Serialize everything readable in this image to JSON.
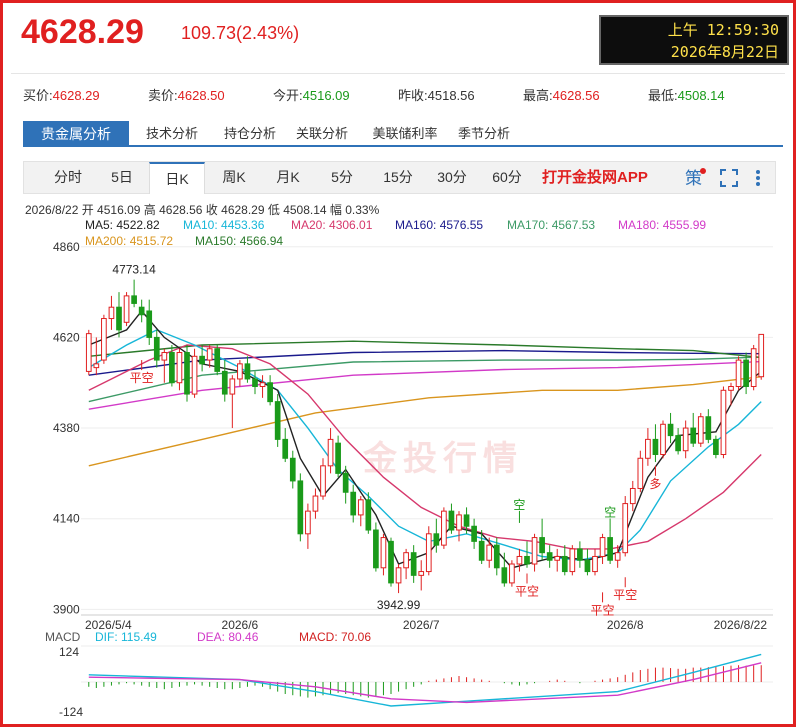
{
  "header": {
    "last_price": "4628.29",
    "change": "109.73(2.43%)",
    "clock_time": "上午 12:59:30",
    "clock_date": "2026年8月22日"
  },
  "quote": [
    {
      "label": "买价:",
      "value": "4628.29",
      "dir": "up"
    },
    {
      "label": "卖价:",
      "value": "4628.50",
      "dir": "up"
    },
    {
      "label": "今开:",
      "value": "4516.09",
      "dir": "down"
    },
    {
      "label": "昨收:",
      "value": "4518.56",
      "dir": "flat"
    },
    {
      "label": "最高:",
      "value": "4628.56",
      "dir": "up"
    },
    {
      "label": "最低:",
      "value": "4508.14",
      "dir": "down"
    }
  ],
  "nav_tabs": [
    "贵金属分析",
    "技术分析",
    "持仓分析",
    "关联分析",
    "美联储利率",
    "季节分析"
  ],
  "period_tabs": [
    "分时",
    "5日",
    "日K",
    "周K",
    "月K",
    "5分",
    "15分",
    "30分",
    "60分"
  ],
  "app_link": "打开金投网APP",
  "icons": {
    "settings": "settings-icon",
    "fullscreen": "fullscreen-icon",
    "more": "more-icon"
  },
  "ohlc_text": "2026/8/22 开 4516.09 高 4628.56 收 4628.29 低 4508.14 幅 0.33%",
  "ma_legend": [
    {
      "text": "MA5: 4522.82",
      "color": "#222222"
    },
    {
      "text": "MA10: 4453.36",
      "color": "#17b6d8"
    },
    {
      "text": "MA20: 4306.01",
      "color": "#d6386c"
    },
    {
      "text": "MA160: 4576.55",
      "color": "#1a1a8c"
    },
    {
      "text": "MA170: 4567.53",
      "color": "#3c9a66"
    },
    {
      "text": "MA180: 4555.99",
      "color": "#d23ac8"
    },
    {
      "text": "MA200: 4515.72",
      "color": "#d9951e"
    },
    {
      "text": "MA150: 4566.94",
      "color": "#2a7a2a"
    }
  ],
  "macd_legend": [
    {
      "text": "MACD",
      "color": "#555555"
    },
    {
      "text": "DIF: 115.49",
      "color": "#17b6d8"
    },
    {
      "text": "DEA: 80.46",
      "color": "#d23ac8"
    },
    {
      "text": "MACD: 70.06",
      "color": "#d12020"
    }
  ],
  "watermark": "金投行情",
  "colors": {
    "up": "#e02020",
    "down": "#1a9a1a",
    "accent": "#2f72b8"
  },
  "chart_data": {
    "type": "candlestick",
    "y_ticks": [
      4860,
      4620,
      4380,
      4140,
      3900
    ],
    "ylim": [
      3885,
      4870
    ],
    "x_ticks": [
      "2026/5/4",
      "2026/6",
      "2026/7",
      "2026/8",
      "2026/8/22"
    ],
    "annotations": {
      "high": "4773.14",
      "low": "3942.99"
    },
    "signals": [
      "平空",
      "空",
      "平空",
      "空",
      "平空",
      "平空",
      "多"
    ],
    "candles": [
      {
        "o": 4530,
        "h": 4640,
        "l": 4520,
        "c": 4630
      },
      {
        "o": 4540,
        "h": 4620,
        "l": 4520,
        "c": 4550
      },
      {
        "o": 4560,
        "h": 4680,
        "l": 4550,
        "c": 4670
      },
      {
        "o": 4670,
        "h": 4730,
        "l": 4640,
        "c": 4700
      },
      {
        "o": 4700,
        "h": 4740,
        "l": 4620,
        "c": 4640
      },
      {
        "o": 4660,
        "h": 4740,
        "l": 4650,
        "c": 4730
      },
      {
        "o": 4730,
        "h": 4773,
        "l": 4700,
        "c": 4710
      },
      {
        "o": 4700,
        "h": 4720,
        "l": 4660,
        "c": 4680
      },
      {
        "o": 4690,
        "h": 4720,
        "l": 4600,
        "c": 4620
      },
      {
        "o": 4620,
        "h": 4640,
        "l": 4540,
        "c": 4560
      },
      {
        "o": 4560,
        "h": 4590,
        "l": 4500,
        "c": 4580
      },
      {
        "o": 4580,
        "h": 4600,
        "l": 4490,
        "c": 4500
      },
      {
        "o": 4500,
        "h": 4590,
        "l": 4480,
        "c": 4580
      },
      {
        "o": 4580,
        "h": 4600,
        "l": 4450,
        "c": 4470
      },
      {
        "o": 4470,
        "h": 4590,
        "l": 4460,
        "c": 4570
      },
      {
        "o": 4570,
        "h": 4600,
        "l": 4530,
        "c": 4550
      },
      {
        "o": 4560,
        "h": 4600,
        "l": 4540,
        "c": 4590
      },
      {
        "o": 4590,
        "h": 4600,
        "l": 4520,
        "c": 4530
      },
      {
        "o": 4530,
        "h": 4560,
        "l": 4450,
        "c": 4470
      },
      {
        "o": 4470,
        "h": 4520,
        "l": 4380,
        "c": 4510
      },
      {
        "o": 4510,
        "h": 4560,
        "l": 4490,
        "c": 4550
      },
      {
        "o": 4550,
        "h": 4570,
        "l": 4500,
        "c": 4510
      },
      {
        "o": 4510,
        "h": 4530,
        "l": 4470,
        "c": 4490
      },
      {
        "o": 4490,
        "h": 4520,
        "l": 4460,
        "c": 4500
      },
      {
        "o": 4500,
        "h": 4520,
        "l": 4440,
        "c": 4450
      },
      {
        "o": 4450,
        "h": 4470,
        "l": 4330,
        "c": 4350
      },
      {
        "o": 4350,
        "h": 4380,
        "l": 4290,
        "c": 4300
      },
      {
        "o": 4300,
        "h": 4320,
        "l": 4220,
        "c": 4240
      },
      {
        "o": 4240,
        "h": 4260,
        "l": 4080,
        "c": 4100
      },
      {
        "o": 4100,
        "h": 4180,
        "l": 4060,
        "c": 4160
      },
      {
        "o": 4160,
        "h": 4220,
        "l": 4140,
        "c": 4200
      },
      {
        "o": 4200,
        "h": 4300,
        "l": 4190,
        "c": 4280
      },
      {
        "o": 4280,
        "h": 4380,
        "l": 4260,
        "c": 4350
      },
      {
        "o": 4340,
        "h": 4360,
        "l": 4250,
        "c": 4260
      },
      {
        "o": 4260,
        "h": 4280,
        "l": 4180,
        "c": 4210
      },
      {
        "o": 4210,
        "h": 4230,
        "l": 4130,
        "c": 4150
      },
      {
        "o": 4150,
        "h": 4200,
        "l": 4120,
        "c": 4190
      },
      {
        "o": 4190,
        "h": 4210,
        "l": 4100,
        "c": 4110
      },
      {
        "o": 4110,
        "h": 4130,
        "l": 4000,
        "c": 4010
      },
      {
        "o": 4010,
        "h": 4100,
        "l": 3990,
        "c": 4090
      },
      {
        "o": 4080,
        "h": 4090,
        "l": 3960,
        "c": 3970
      },
      {
        "o": 3970,
        "h": 4020,
        "l": 3943,
        "c": 4010
      },
      {
        "o": 4010,
        "h": 4060,
        "l": 3980,
        "c": 4050
      },
      {
        "o": 4050,
        "h": 4070,
        "l": 3970,
        "c": 3990
      },
      {
        "o": 3990,
        "h": 4030,
        "l": 3950,
        "c": 4000
      },
      {
        "o": 4000,
        "h": 4120,
        "l": 3990,
        "c": 4100
      },
      {
        "o": 4100,
        "h": 4140,
        "l": 4050,
        "c": 4070
      },
      {
        "o": 4070,
        "h": 4170,
        "l": 4060,
        "c": 4160
      },
      {
        "o": 4160,
        "h": 4180,
        "l": 4100,
        "c": 4110
      },
      {
        "o": 4110,
        "h": 4160,
        "l": 4080,
        "c": 4150
      },
      {
        "o": 4150,
        "h": 4170,
        "l": 4100,
        "c": 4120
      },
      {
        "o": 4120,
        "h": 4140,
        "l": 4060,
        "c": 4080
      },
      {
        "o": 4080,
        "h": 4110,
        "l": 4020,
        "c": 4030
      },
      {
        "o": 4030,
        "h": 4090,
        "l": 4010,
        "c": 4070
      },
      {
        "o": 4070,
        "h": 4090,
        "l": 3990,
        "c": 4010
      },
      {
        "o": 4010,
        "h": 4050,
        "l": 3960,
        "c": 3970
      },
      {
        "o": 3970,
        "h": 4030,
        "l": 3960,
        "c": 4020
      },
      {
        "o": 4020,
        "h": 4060,
        "l": 4000,
        "c": 4040
      },
      {
        "o": 4040,
        "h": 4080,
        "l": 4010,
        "c": 4020
      },
      {
        "o": 4020,
        "h": 4100,
        "l": 4000,
        "c": 4090
      },
      {
        "o": 4090,
        "h": 4140,
        "l": 4030,
        "c": 4050
      },
      {
        "o": 4050,
        "h": 4070,
        "l": 4010,
        "c": 4030
      },
      {
        "o": 4030,
        "h": 4060,
        "l": 4000,
        "c": 4040
      },
      {
        "o": 4040,
        "h": 4070,
        "l": 3990,
        "c": 4000
      },
      {
        "o": 4000,
        "h": 4070,
        "l": 3990,
        "c": 4060
      },
      {
        "o": 4060,
        "h": 4080,
        "l": 4010,
        "c": 4030
      },
      {
        "o": 4030,
        "h": 4060,
        "l": 3990,
        "c": 4000
      },
      {
        "o": 4000,
        "h": 4060,
        "l": 3990,
        "c": 4040
      },
      {
        "o": 4040,
        "h": 4100,
        "l": 4020,
        "c": 4090
      },
      {
        "o": 4090,
        "h": 4110,
        "l": 4020,
        "c": 4030
      },
      {
        "o": 4030,
        "h": 4070,
        "l": 4010,
        "c": 4050
      },
      {
        "o": 4050,
        "h": 4200,
        "l": 4040,
        "c": 4180
      },
      {
        "o": 4180,
        "h": 4240,
        "l": 4160,
        "c": 4220
      },
      {
        "o": 4220,
        "h": 4320,
        "l": 4210,
        "c": 4300
      },
      {
        "o": 4300,
        "h": 4380,
        "l": 4280,
        "c": 4350
      },
      {
        "o": 4350,
        "h": 4390,
        "l": 4290,
        "c": 4310
      },
      {
        "o": 4310,
        "h": 4400,
        "l": 4300,
        "c": 4390
      },
      {
        "o": 4390,
        "h": 4420,
        "l": 4340,
        "c": 4360
      },
      {
        "o": 4360,
        "h": 4380,
        "l": 4310,
        "c": 4320
      },
      {
        "o": 4320,
        "h": 4400,
        "l": 4300,
        "c": 4380
      },
      {
        "o": 4380,
        "h": 4420,
        "l": 4330,
        "c": 4340
      },
      {
        "o": 4340,
        "h": 4420,
        "l": 4330,
        "c": 4410
      },
      {
        "o": 4410,
        "h": 4430,
        "l": 4340,
        "c": 4350
      },
      {
        "o": 4350,
        "h": 4360,
        "l": 4300,
        "c": 4310
      },
      {
        "o": 4310,
        "h": 4490,
        "l": 4300,
        "c": 4480
      },
      {
        "o": 4480,
        "h": 4500,
        "l": 4440,
        "c": 4490
      },
      {
        "o": 4490,
        "h": 4570,
        "l": 4480,
        "c": 4560
      },
      {
        "o": 4560,
        "h": 4580,
        "l": 4470,
        "c": 4490
      },
      {
        "o": 4490,
        "h": 4600,
        "l": 4480,
        "c": 4590
      },
      {
        "o": 4516,
        "h": 4629,
        "l": 4508,
        "c": 4628
      }
    ],
    "ma_series": [
      {
        "name": "MA5",
        "color": "#222222",
        "points": [
          [
            0,
            4600
          ],
          [
            5,
            4640
          ],
          [
            7,
            4690
          ],
          [
            10,
            4620
          ],
          [
            15,
            4550
          ],
          [
            20,
            4530
          ],
          [
            25,
            4480
          ],
          [
            28,
            4300
          ],
          [
            31,
            4200
          ],
          [
            34,
            4270
          ],
          [
            38,
            4150
          ],
          [
            41,
            4020
          ],
          [
            45,
            4050
          ],
          [
            48,
            4120
          ],
          [
            52,
            4100
          ],
          [
            56,
            4010
          ],
          [
            62,
            4040
          ],
          [
            66,
            4030
          ],
          [
            70,
            4050
          ],
          [
            74,
            4250
          ],
          [
            78,
            4360
          ],
          [
            83,
            4370
          ],
          [
            86,
            4480
          ],
          [
            89,
            4530
          ]
        ]
      },
      {
        "name": "MA10",
        "color": "#17b6d8",
        "points": [
          [
            0,
            4540
          ],
          [
            5,
            4600
          ],
          [
            9,
            4640
          ],
          [
            14,
            4600
          ],
          [
            20,
            4540
          ],
          [
            25,
            4480
          ],
          [
            29,
            4380
          ],
          [
            33,
            4270
          ],
          [
            37,
            4200
          ],
          [
            41,
            4120
          ],
          [
            45,
            4080
          ],
          [
            50,
            4100
          ],
          [
            55,
            4070
          ],
          [
            60,
            4040
          ],
          [
            65,
            4030
          ],
          [
            70,
            4050
          ],
          [
            73,
            4110
          ],
          [
            77,
            4240
          ],
          [
            82,
            4330
          ],
          [
            86,
            4390
          ],
          [
            89,
            4450
          ]
        ]
      },
      {
        "name": "MA20",
        "color": "#d6386c",
        "points": [
          [
            0,
            4480
          ],
          [
            3,
            4510
          ],
          [
            8,
            4560
          ],
          [
            13,
            4600
          ],
          [
            19,
            4590
          ],
          [
            24,
            4550
          ],
          [
            29,
            4470
          ],
          [
            34,
            4350
          ],
          [
            39,
            4250
          ],
          [
            44,
            4170
          ],
          [
            49,
            4120
          ],
          [
            54,
            4090
          ],
          [
            59,
            4080
          ],
          [
            64,
            4060
          ],
          [
            69,
            4060
          ],
          [
            74,
            4080
          ],
          [
            79,
            4140
          ],
          [
            84,
            4210
          ],
          [
            89,
            4310
          ]
        ]
      },
      {
        "name": "MA150",
        "color": "#2a7a2a",
        "points": [
          [
            0,
            4570
          ],
          [
            15,
            4600
          ],
          [
            35,
            4610
          ],
          [
            55,
            4600
          ],
          [
            70,
            4590
          ],
          [
            80,
            4585
          ],
          [
            89,
            4567
          ]
        ]
      },
      {
        "name": "MA160",
        "color": "#1a1a8c",
        "points": [
          [
            0,
            4520
          ],
          [
            15,
            4560
          ],
          [
            35,
            4580
          ],
          [
            55,
            4585
          ],
          [
            70,
            4580
          ],
          [
            80,
            4578
          ],
          [
            89,
            4577
          ]
        ]
      },
      {
        "name": "MA170",
        "color": "#3c9a66",
        "points": [
          [
            0,
            4450
          ],
          [
            15,
            4520
          ],
          [
            35,
            4555
          ],
          [
            55,
            4560
          ],
          [
            70,
            4560
          ],
          [
            80,
            4562
          ],
          [
            89,
            4568
          ]
        ]
      },
      {
        "name": "MA180",
        "color": "#d23ac8",
        "points": [
          [
            0,
            4430
          ],
          [
            15,
            4480
          ],
          [
            35,
            4520
          ],
          [
            55,
            4535
          ],
          [
            70,
            4540
          ],
          [
            80,
            4548
          ],
          [
            89,
            4556
          ]
        ]
      },
      {
        "name": "MA200",
        "color": "#d9951e",
        "points": [
          [
            0,
            4280
          ],
          [
            15,
            4350
          ],
          [
            30,
            4420
          ],
          [
            45,
            4460
          ],
          [
            60,
            4480
          ],
          [
            70,
            4480
          ],
          [
            80,
            4495
          ],
          [
            89,
            4516
          ]
        ]
      }
    ],
    "macd": {
      "y_ticks": [
        124,
        -124
      ],
      "ylim": [
        -150,
        150
      ],
      "dif": [
        [
          0,
          30
        ],
        [
          10,
          20
        ],
        [
          20,
          10
        ],
        [
          30,
          -40
        ],
        [
          40,
          -100
        ],
        [
          50,
          -80
        ],
        [
          60,
          -60
        ],
        [
          70,
          -40
        ],
        [
          80,
          40
        ],
        [
          89,
          115
        ]
      ],
      "dea": [
        [
          0,
          20
        ],
        [
          10,
          15
        ],
        [
          20,
          10
        ],
        [
          30,
          -20
        ],
        [
          40,
          -70
        ],
        [
          50,
          -85
        ],
        [
          60,
          -70
        ],
        [
          70,
          -55
        ],
        [
          80,
          10
        ],
        [
          89,
          80
        ]
      ],
      "hist": [
        -20,
        -25,
        -20,
        -15,
        -10,
        -5,
        -10,
        -15,
        -20,
        -25,
        -30,
        -25,
        -20,
        -15,
        -10,
        -15,
        -20,
        -25,
        -30,
        -30,
        -25,
        -20,
        -15,
        -20,
        -30,
        -40,
        -50,
        -55,
        -60,
        -65,
        -60,
        -55,
        -50,
        -45,
        -50,
        -55,
        -60,
        -65,
        -60,
        -55,
        -50,
        -40,
        -30,
        -20,
        -10,
        5,
        10,
        15,
        20,
        25,
        20,
        15,
        10,
        5,
        0,
        -5,
        -10,
        -15,
        -10,
        -5,
        0,
        5,
        10,
        5,
        0,
        -5,
        0,
        5,
        10,
        15,
        20,
        30,
        40,
        50,
        55,
        60,
        60,
        58,
        55,
        55,
        60,
        60,
        62,
        64,
        66,
        68,
        70,
        68,
        69,
        70
      ]
    }
  }
}
